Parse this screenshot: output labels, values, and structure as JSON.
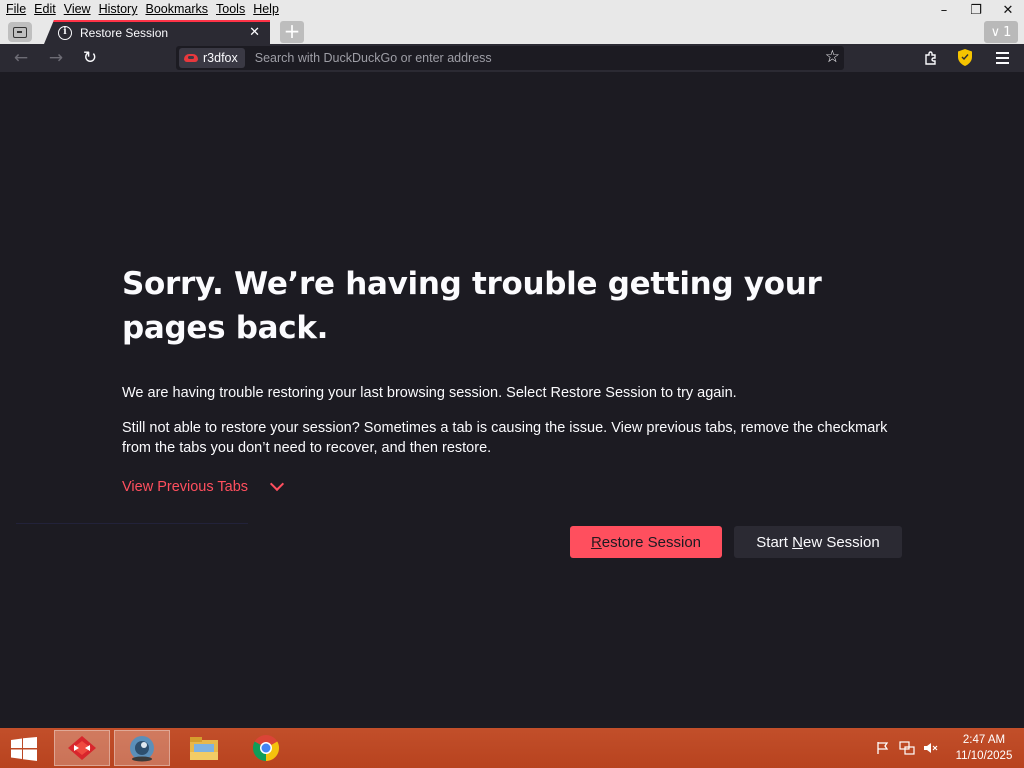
{
  "menubar": {
    "items": [
      {
        "label": "File"
      },
      {
        "label": "Edit"
      },
      {
        "label": "View"
      },
      {
        "label": "History"
      },
      {
        "label": "Bookmarks"
      },
      {
        "label": "Tools"
      },
      {
        "label": "Help"
      }
    ]
  },
  "window_controls": {
    "minimize": "–",
    "restore": "❐",
    "close": "✕"
  },
  "tab": {
    "title": "Restore Session",
    "close": "✕"
  },
  "new_tab": "+",
  "tab_overflow": {
    "chevron": "∨",
    "count": "1"
  },
  "navbar": {
    "back": "←",
    "forward": "→",
    "reload": "↻",
    "identity_label": "r3dfox",
    "url_placeholder": "Search with DuckDuckGo or enter address",
    "bookmark_star": "☆"
  },
  "content": {
    "heading": "Sorry. We’re having trouble getting your pages back.",
    "para1": "We are having trouble restoring your last browsing session. Select Restore Session to try again.",
    "para2": "Still not able to restore your session? Sometimes a tab is causing the issue. View previous tabs, remove the checkmark from the tabs you don’t need to recover, and then restore.",
    "view_previous_tabs": "View Previous Tabs",
    "restore_button": {
      "underlined": "R",
      "rest": "estore Session"
    },
    "new_session_button": {
      "before": "Start ",
      "underlined": "N",
      "after": "ew Session"
    }
  },
  "colors": {
    "accent": "#ff4f5e",
    "page_bg": "#1c1b22",
    "toolbar_bg": "#2b2a33",
    "taskbar": "#c24f2a"
  },
  "taskbar": {
    "apps": [
      {
        "name": "r3dfox"
      },
      {
        "name": "network-globe"
      },
      {
        "name": "file-explorer"
      },
      {
        "name": "chrome"
      }
    ],
    "clock": {
      "time": "2:47 AM",
      "date": "11/10/2025"
    }
  }
}
